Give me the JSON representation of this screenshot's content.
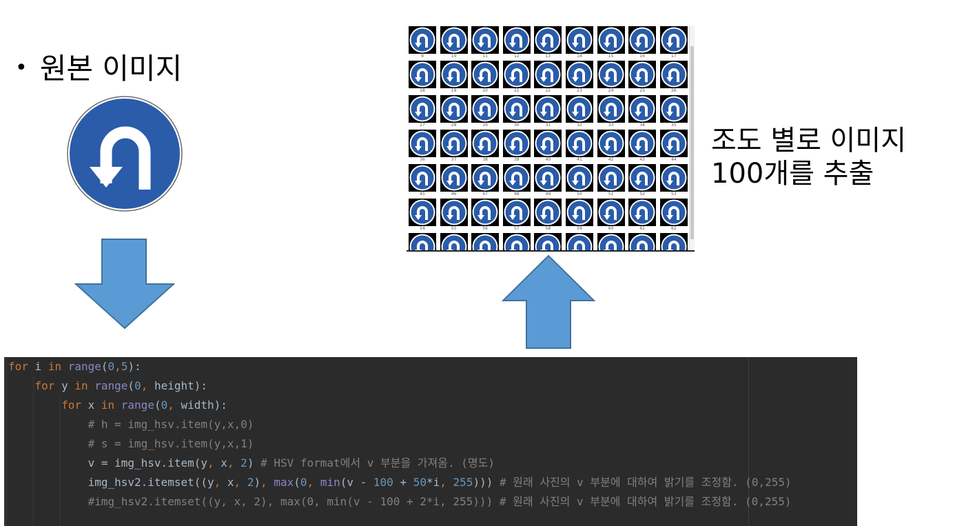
{
  "left": {
    "bullet": "•",
    "title": "원본 이미지"
  },
  "right": {
    "caption_line1": "조도 별로 이미지",
    "caption_line2": "100개를 추출"
  },
  "grid": {
    "columns": 9,
    "labels": [
      [
        "9",
        "10",
        "11",
        "12",
        "13",
        "14",
        "15",
        "16",
        "17"
      ],
      [
        "18",
        "19",
        "20",
        "21",
        "22",
        "23",
        "24",
        "25",
        "26"
      ],
      [
        "27",
        "28",
        "29",
        "30",
        "31",
        "32",
        "33",
        "34",
        "35"
      ],
      [
        "36",
        "37",
        "38",
        "39",
        "40",
        "41",
        "42",
        "43",
        "44"
      ],
      [
        "45",
        "46",
        "47",
        "48",
        "49",
        "50",
        "51",
        "52",
        "53"
      ],
      [
        "54",
        "55",
        "56",
        "57",
        "58",
        "59",
        "60",
        "61",
        "62"
      ],
      [
        "",
        "",
        "",
        "",
        "",
        "",
        "",
        "",
        ""
      ]
    ]
  },
  "code": {
    "lines": [
      "for i in range(0,5):",
      "    for y in range(0, height):",
      "        for x in range(0, width):",
      "            # h = img_hsv.item(y,x,0)",
      "            # s = img_hsv.item(y,x,1)",
      "            v = img_hsv.item(y, x, 2) # HSV format에서 v 부분을 가져옴. (명도)",
      "            img_hsv2.itemset((y, x, 2), max(0, min(v - 100 + 50*i, 255))) # 원래 사진의 v 부분에 대하여 밝기를 조정함. (0,255)",
      "            #img_hsv2.itemset((y, x, 2), max(0, min(v - 100 + 2*i, 255))) # 원래 사진의 v 부분에 대하여 밝기를 조정함. (0,255)"
    ]
  },
  "colors": {
    "sign_blue": "#2a5caa",
    "arrow_blue": "#5b9bd5",
    "arrow_border": "#41719c",
    "code_bg": "#2b2b2b",
    "keyword": "#cc7832",
    "number": "#6897bb",
    "builtin": "#8888c6",
    "comment": "#808080"
  },
  "icons": {
    "sign": "u-turn-sign-icon",
    "down": "arrow-down-icon",
    "up": "arrow-up-icon"
  }
}
